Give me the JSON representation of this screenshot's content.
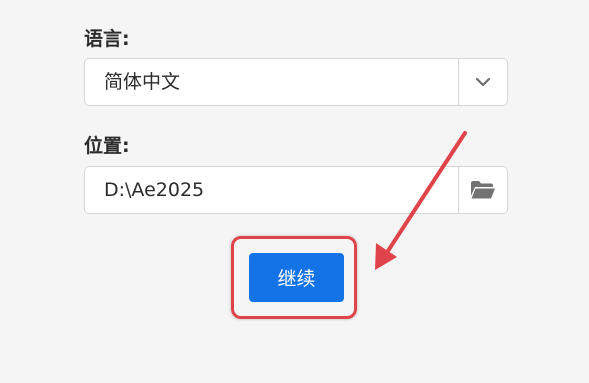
{
  "language": {
    "label": "语言:",
    "selected_value": "简体中文",
    "dropdown_icon": "chevron-down-icon"
  },
  "location": {
    "label": "位置:",
    "value": "D:\\Ae2025",
    "browse_icon": "folder-icon"
  },
  "continue_button": {
    "label": "继续"
  },
  "annotation": {
    "highlight_color": "#e0434a",
    "arrow_color": "#e0434a"
  },
  "colors": {
    "background": "#f5f5f5",
    "primary_button": "#1473e6",
    "field_border": "#d6d6d6"
  }
}
